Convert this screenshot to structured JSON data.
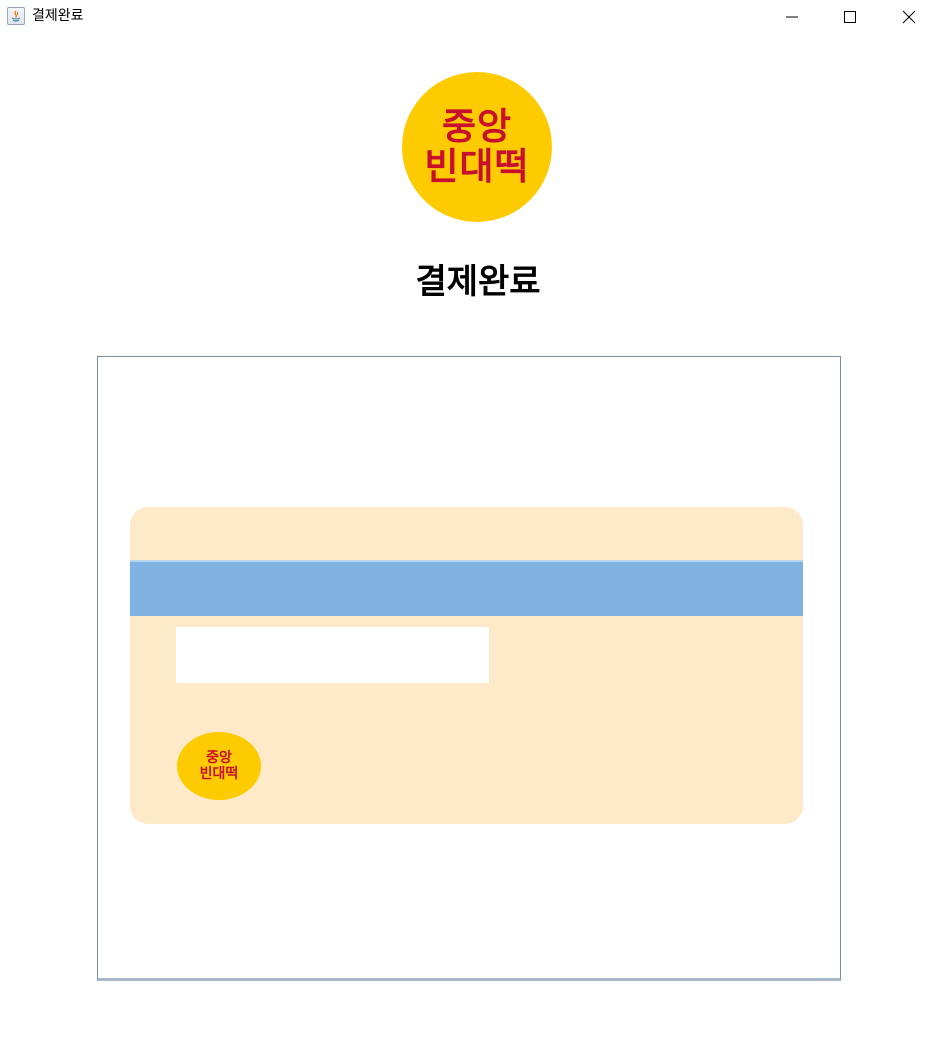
{
  "window": {
    "title": "결제완료",
    "icon": "java-icon",
    "controls": [
      "minimize-icon",
      "maximize-icon",
      "close-icon"
    ]
  },
  "logo": {
    "line1": "중앙",
    "line2": "빈대떡",
    "color_bg": "#fecb00",
    "color_text": "#c8102e"
  },
  "heading": "결제완료",
  "card": {
    "logo_line1": "중앙",
    "logo_line2": "빈대떡",
    "color_bg": "#feeac8",
    "color_stripe": "#80b2e2"
  }
}
